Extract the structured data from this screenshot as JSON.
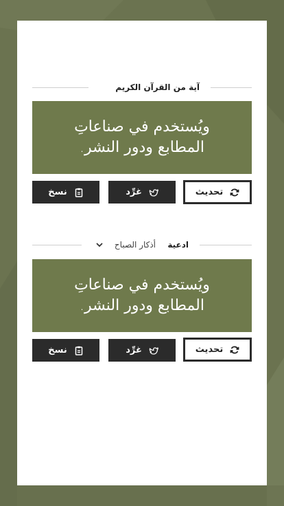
{
  "sections": [
    {
      "heading": "آية من القرآن الكريم",
      "quote": "ويُستخدم في صناعاتِ المطابع ودور النشر.",
      "buttons": {
        "refresh": "تحديث",
        "tweet": "غرِّد",
        "copy": "نسخ"
      }
    },
    {
      "heading": "ادعية",
      "selector": "أذكار الصباح",
      "quote": "ويُستخدم في صناعاتِ المطابع ودور النشر.",
      "buttons": {
        "refresh": "تحديث",
        "tweet": "غرِّد",
        "copy": "نسخ"
      }
    }
  ],
  "colors": {
    "background": "#6b7350",
    "quote_box": "#6f7a4c",
    "button_dark": "#2b2b2b"
  },
  "icons": [
    "refresh-icon",
    "bird-icon",
    "clipboard-icon",
    "chevron-down-icon"
  ]
}
